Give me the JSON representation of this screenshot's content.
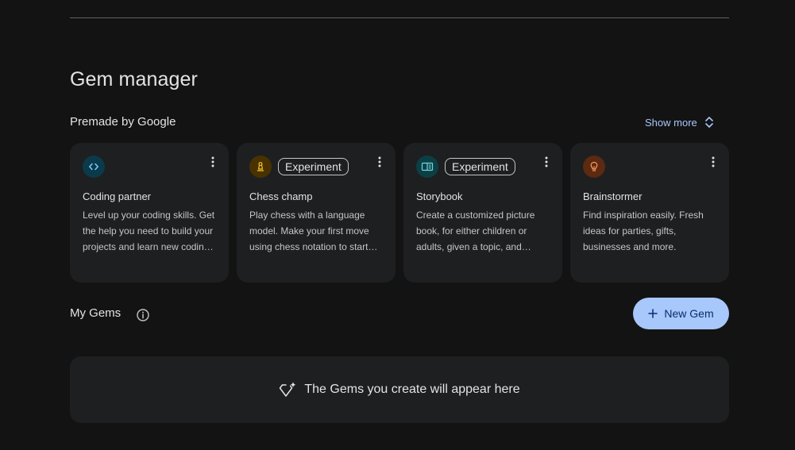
{
  "page": {
    "title": "Gem manager"
  },
  "premade": {
    "heading": "Premade by Google",
    "show_more_label": "Show more",
    "cards": [
      {
        "title": "Coding partner",
        "description": "Level up your coding skills. Get the help you need to build your projects and learn new coding techniques.",
        "badge": "",
        "icon": "code-icon",
        "icon_bg": "#0b3a4a",
        "icon_color": "#7fcfff"
      },
      {
        "title": "Chess champ",
        "description": "Play chess with a language model. Make your first move using chess notation to start the game.",
        "badge": "Experiment",
        "icon": "chess-pawn-icon",
        "icon_bg": "#4a3200",
        "icon_color": "#fcc934"
      },
      {
        "title": "Storybook",
        "description": "Create a customized picture book, for either children or adults, given a topic, and audience.",
        "badge": "Experiment",
        "icon": "book-icon",
        "icon_bg": "#0c3f44",
        "icon_color": "#6fd8e0"
      },
      {
        "title": "Brainstormer",
        "description": "Find inspiration easily. Fresh ideas for parties, gifts, businesses and more.",
        "badge": "",
        "icon": "lightbulb-icon",
        "icon_bg": "#5b2a10",
        "icon_color": "#ff9a5c"
      }
    ]
  },
  "my_gems": {
    "heading": "My Gems",
    "new_gem_label": "New Gem",
    "empty_text": "The Gems you create will appear here"
  },
  "colors": {
    "background": "#131314",
    "surface": "#1e1f20",
    "accent": "#a8c7fa",
    "accent_text": "#062e6f"
  }
}
